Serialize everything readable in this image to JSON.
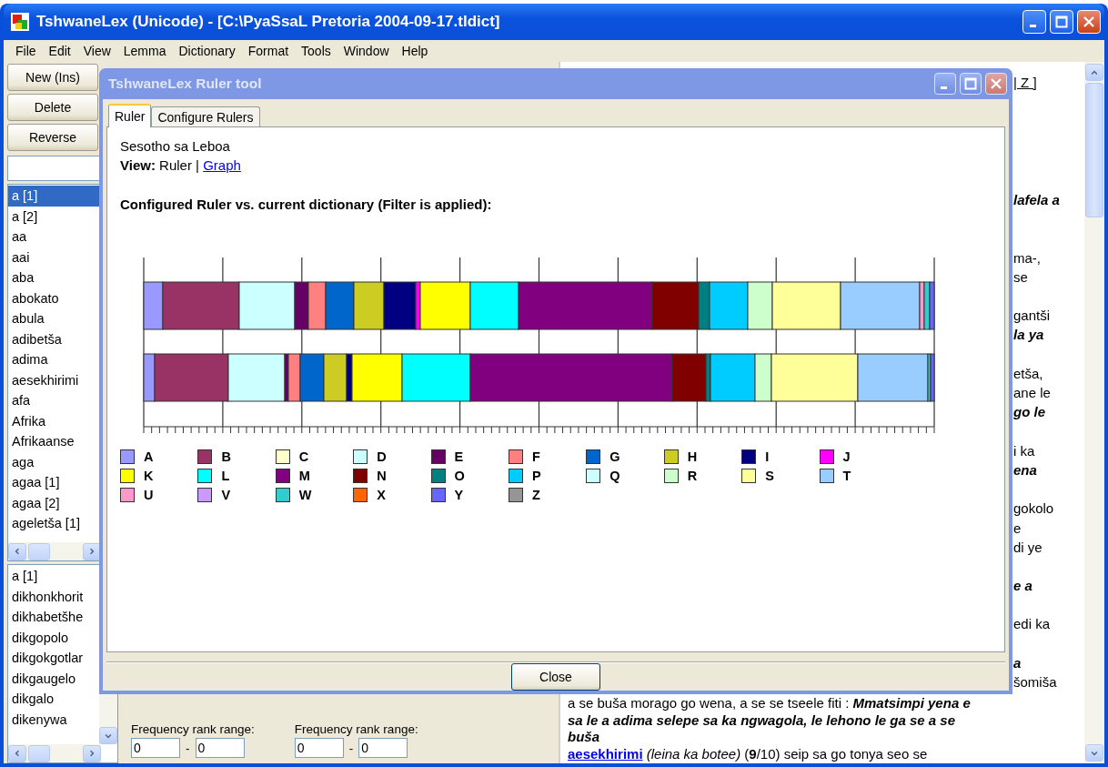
{
  "window": {
    "title": "TshwaneLex (Unicode) - [C:\\PyaSsaL Pretoria 2004-09-17.tldict]"
  },
  "menu": [
    "File",
    "Edit",
    "View",
    "Lemma",
    "Dictionary",
    "Format",
    "Tools",
    "Window",
    "Help"
  ],
  "left_buttons": [
    "New (Ins)",
    "Delete",
    "Reverse"
  ],
  "lemma_list": [
    {
      "label": "a [1]",
      "selected": true
    },
    {
      "label": "a [2]",
      "selected": false
    },
    {
      "label": "aa",
      "selected": false
    },
    {
      "label": "aai",
      "selected": false
    },
    {
      "label": "aba",
      "selected": false
    },
    {
      "label": "abokato",
      "selected": false
    },
    {
      "label": "abula",
      "selected": false
    },
    {
      "label": "adibetša",
      "selected": false
    },
    {
      "label": "adima",
      "selected": false
    },
    {
      "label": "aesekhirimi",
      "selected": false
    },
    {
      "label": "afa",
      "selected": false
    },
    {
      "label": "Afrika",
      "selected": false
    },
    {
      "label": "Afrikaanse",
      "selected": false
    },
    {
      "label": "aga",
      "selected": false
    },
    {
      "label": "agaa [1]",
      "selected": false
    },
    {
      "label": "agaa [2]",
      "selected": false
    },
    {
      "label": "ageletša [1]",
      "selected": false
    }
  ],
  "reverse_list": [
    "a [1]",
    "dikhonkhorit",
    "dikhabetšhe",
    "dikgopolo",
    "dikgokgotlar",
    "dikgaugelo",
    "dikgalo",
    "dikenywa"
  ],
  "filters": [
    {
      "label": "Frequency rank range:",
      "from": "0",
      "separator": "-",
      "to": "0"
    },
    {
      "label": "Frequency rank range:",
      "from": "0",
      "separator": "-",
      "to": "0"
    }
  ],
  "entry_text": {
    "clipped": [
      [
        {
          "text": "| Z ]",
          "kind": "link"
        }
      ],
      [
        {
          "text": "lafela a",
          "kind": "emphasis"
        }
      ],
      [
        {
          "text": "ma-,",
          "kind": "plain"
        }
      ],
      [
        {
          "text": "se",
          "kind": "plain"
        }
      ],
      [
        {
          "text": "gantši",
          "kind": "plain"
        }
      ],
      [
        {
          "text": "la ya",
          "kind": "emphasis"
        }
      ],
      [
        {
          "text": "etša,",
          "kind": "plain"
        }
      ],
      [
        {
          "text": "ane le",
          "kind": "plain"
        }
      ],
      [
        {
          "text": "go le",
          "kind": "emphasis"
        }
      ],
      [
        {
          "text": "i ka",
          "kind": "plain"
        }
      ],
      [
        {
          "text": "ena",
          "kind": "emphasis"
        }
      ],
      [
        {
          "text": "gokolo",
          "kind": "plain"
        }
      ],
      [
        {
          "text": "e",
          "kind": "plain"
        }
      ],
      [
        {
          "text": "di ye",
          "kind": "plain"
        }
      ],
      [
        {
          "text": "e a",
          "kind": "emphasis"
        }
      ],
      [
        {
          "text": "edi ka",
          "kind": "plain"
        }
      ],
      [
        {
          "text": "a",
          "kind": "emphasis"
        }
      ],
      [
        {
          "text": "šomiša",
          "kind": "plain"
        }
      ]
    ],
    "full": [
      [
        {
          "text": "a se buša morago go wena, a se se tseele fiti : ",
          "kind": "plain"
        },
        {
          "text": "Mmatsimpi yena e",
          "kind": "emphasis"
        }
      ],
      [
        {
          "text": "sa le a adima selepe sa ka ngwagola, le lehono le ga se a se",
          "kind": "emphasis"
        }
      ],
      [
        {
          "text": "buša",
          "kind": "emphasis"
        }
      ],
      [
        {
          "text": "aesekhirimi",
          "kind": "link"
        },
        {
          "text": " (leina ka botee)",
          "kind": "italic"
        },
        {
          "text": " (",
          "kind": "plain"
        },
        {
          "text": "9",
          "kind": "bold"
        },
        {
          "text": "/10) seip sa go tonya seo se",
          "kind": "plain"
        }
      ]
    ]
  },
  "dialog": {
    "title": "TshwaneLex Ruler tool",
    "tabs": [
      {
        "label": "Ruler",
        "selected": true
      },
      {
        "label": "Configure Rulers",
        "selected": false
      }
    ],
    "language": "Sesotho sa Leboa",
    "view_label": "View:",
    "view_current": "Ruler",
    "view_separator": "|",
    "view_link": "Graph",
    "heading": "Configured Ruler vs. current dictionary (Filter is applied):",
    "legend": [
      {
        "label": "A",
        "color": "#9999ff"
      },
      {
        "label": "B",
        "color": "#993366"
      },
      {
        "label": "C",
        "color": "#ffffcc"
      },
      {
        "label": "D",
        "color": "#ccffff"
      },
      {
        "label": "E",
        "color": "#660066"
      },
      {
        "label": "F",
        "color": "#ff8080"
      },
      {
        "label": "G",
        "color": "#0066cc"
      },
      {
        "label": "H",
        "color": "#cccc22"
      },
      {
        "label": "I",
        "color": "#000080"
      },
      {
        "label": "J",
        "color": "#ff00ff"
      },
      {
        "label": "K",
        "color": "#ffff00"
      },
      {
        "label": "L",
        "color": "#00ffff"
      },
      {
        "label": "M",
        "color": "#800080"
      },
      {
        "label": "N",
        "color": "#800000"
      },
      {
        "label": "O",
        "color": "#008080"
      },
      {
        "label": "P",
        "color": "#00ccff"
      },
      {
        "label": "Q",
        "color": "#ccffff"
      },
      {
        "label": "R",
        "color": "#ccffcc"
      },
      {
        "label": "S",
        "color": "#ffff99"
      },
      {
        "label": "T",
        "color": "#99ccff"
      },
      {
        "label": "U",
        "color": "#ff99cc"
      },
      {
        "label": "V",
        "color": "#cc99ff"
      },
      {
        "label": "W",
        "color": "#33cccc"
      },
      {
        "label": "X",
        "color": "#ff6600"
      },
      {
        "label": "Y",
        "color": "#6666ff"
      },
      {
        "label": "Z",
        "color": "#969696"
      }
    ],
    "close_button": "Close"
  }
}
